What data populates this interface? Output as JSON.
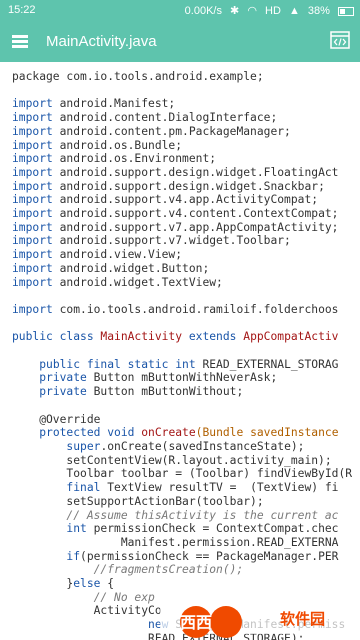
{
  "status": {
    "time": "15:22",
    "speed": "0.00K/s",
    "network": "HD",
    "battery": "38%"
  },
  "toolbar": {
    "title": "MainActivity.java"
  },
  "code_lines": [
    [
      [
        "t",
        "package com.io.tools.android.example;"
      ]
    ],
    [],
    [
      [
        "k",
        "import"
      ],
      [
        "t",
        " android.Manifest;"
      ]
    ],
    [
      [
        "k",
        "import"
      ],
      [
        "t",
        " android.content.DialogInterface;"
      ]
    ],
    [
      [
        "k",
        "import"
      ],
      [
        "t",
        " android.content.pm.PackageManager;"
      ]
    ],
    [
      [
        "k",
        "import"
      ],
      [
        "t",
        " android.os.Bundle;"
      ]
    ],
    [
      [
        "k",
        "import"
      ],
      [
        "t",
        " android.os.Environment;"
      ]
    ],
    [
      [
        "k",
        "import"
      ],
      [
        "t",
        " android.support.design.widget.FloatingAct"
      ]
    ],
    [
      [
        "k",
        "import"
      ],
      [
        "t",
        " android.support.design.widget.Snackbar;"
      ]
    ],
    [
      [
        "k",
        "import"
      ],
      [
        "t",
        " android.support.v4.app.ActivityCompat;"
      ]
    ],
    [
      [
        "k",
        "import"
      ],
      [
        "t",
        " android.support.v4.content.ContextCompat;"
      ]
    ],
    [
      [
        "k",
        "import"
      ],
      [
        "t",
        " android.support.v7.app.AppCompatActivity;"
      ]
    ],
    [
      [
        "k",
        "import"
      ],
      [
        "t",
        " android.support.v7.widget.Toolbar;"
      ]
    ],
    [
      [
        "k",
        "import"
      ],
      [
        "t",
        " android.view.View;"
      ]
    ],
    [
      [
        "k",
        "import"
      ],
      [
        "t",
        " android.widget.Button;"
      ]
    ],
    [
      [
        "k",
        "import"
      ],
      [
        "t",
        " android.widget.TextView;"
      ]
    ],
    [],
    [
      [
        "k",
        "import"
      ],
      [
        "t",
        " com.io.tools.android.ramiloif.folderchoos"
      ]
    ],
    [],
    [
      [
        "k",
        "public class "
      ],
      [
        "c",
        "MainActivity"
      ],
      [
        "k",
        " extends "
      ],
      [
        "c",
        "AppCompatActiv"
      ]
    ],
    [],
    [
      [
        "t",
        "    "
      ],
      [
        "k",
        "public final static int"
      ],
      [
        "t",
        " READ_EXTERNAL_STORAG"
      ]
    ],
    [
      [
        "t",
        "    "
      ],
      [
        "k",
        "private"
      ],
      [
        "t",
        " Button mButtonWithNeverAsk;"
      ]
    ],
    [
      [
        "t",
        "    "
      ],
      [
        "k",
        "private"
      ],
      [
        "t",
        " Button mButtonWithout;"
      ]
    ],
    [],
    [
      [
        "t",
        "    @Override"
      ]
    ],
    [
      [
        "t",
        "    "
      ],
      [
        "k",
        "protected void "
      ],
      [
        "c",
        "onCreate"
      ],
      [
        "m",
        "(Bundle savedInstance"
      ]
    ],
    [
      [
        "t",
        "        "
      ],
      [
        "k",
        "super"
      ],
      [
        "t",
        ".onCreate(savedInstanceState);"
      ]
    ],
    [
      [
        "t",
        "        setContentView(R.layout.activity_main);"
      ]
    ],
    [
      [
        "t",
        "        Toolbar toolbar = (Toolbar) findViewById(R"
      ]
    ],
    [
      [
        "t",
        "        "
      ],
      [
        "k",
        "final"
      ],
      [
        "t",
        " TextView resultTV =  (TextView) fi"
      ]
    ],
    [
      [
        "t",
        "        setSupportActionBar(toolbar);"
      ]
    ],
    [
      [
        "t",
        "        "
      ],
      [
        "s",
        "// Assume thisActivity is the current ac"
      ]
    ],
    [
      [
        "t",
        "        "
      ],
      [
        "k",
        "int"
      ],
      [
        "t",
        " permissionCheck = ContextCompat.chec"
      ]
    ],
    [
      [
        "t",
        "                Manifest.permission.READ_EXTERNA"
      ]
    ],
    [
      [
        "t",
        "        "
      ],
      [
        "k",
        "if"
      ],
      [
        "t",
        "(permissionCheck == PackageManager.PER"
      ]
    ],
    [
      [
        "t",
        "            "
      ],
      [
        "s",
        "//fragmentsCreation();"
      ]
    ],
    [
      [
        "t",
        "        }"
      ],
      [
        "k",
        "else"
      ],
      [
        "t",
        " {"
      ]
    ],
    [
      [
        "t",
        "            "
      ],
      [
        "s",
        "// No exp"
      ]
    ],
    [
      [
        "t",
        "            ActivityCo"
      ]
    ],
    [
      [
        "t",
        "                    "
      ],
      [
        "k",
        "new"
      ],
      [
        "t",
        " String[]{Manifest.permiss"
      ]
    ],
    [
      [
        "t",
        "                    READ_EXTERNAL_STORAGE);"
      ]
    ]
  ],
  "watermark": {
    "logo_text": "西西",
    "site_text": "软件园",
    "icon": "watermark-logo"
  },
  "icons": {
    "menu": "hamburger-menu-icon",
    "code": "code-view-icon"
  },
  "colors": {
    "toolbar": "#5ec4ad",
    "keyword": "#1a55a8",
    "class": "#a31515",
    "comment": "#7a7a7a"
  }
}
